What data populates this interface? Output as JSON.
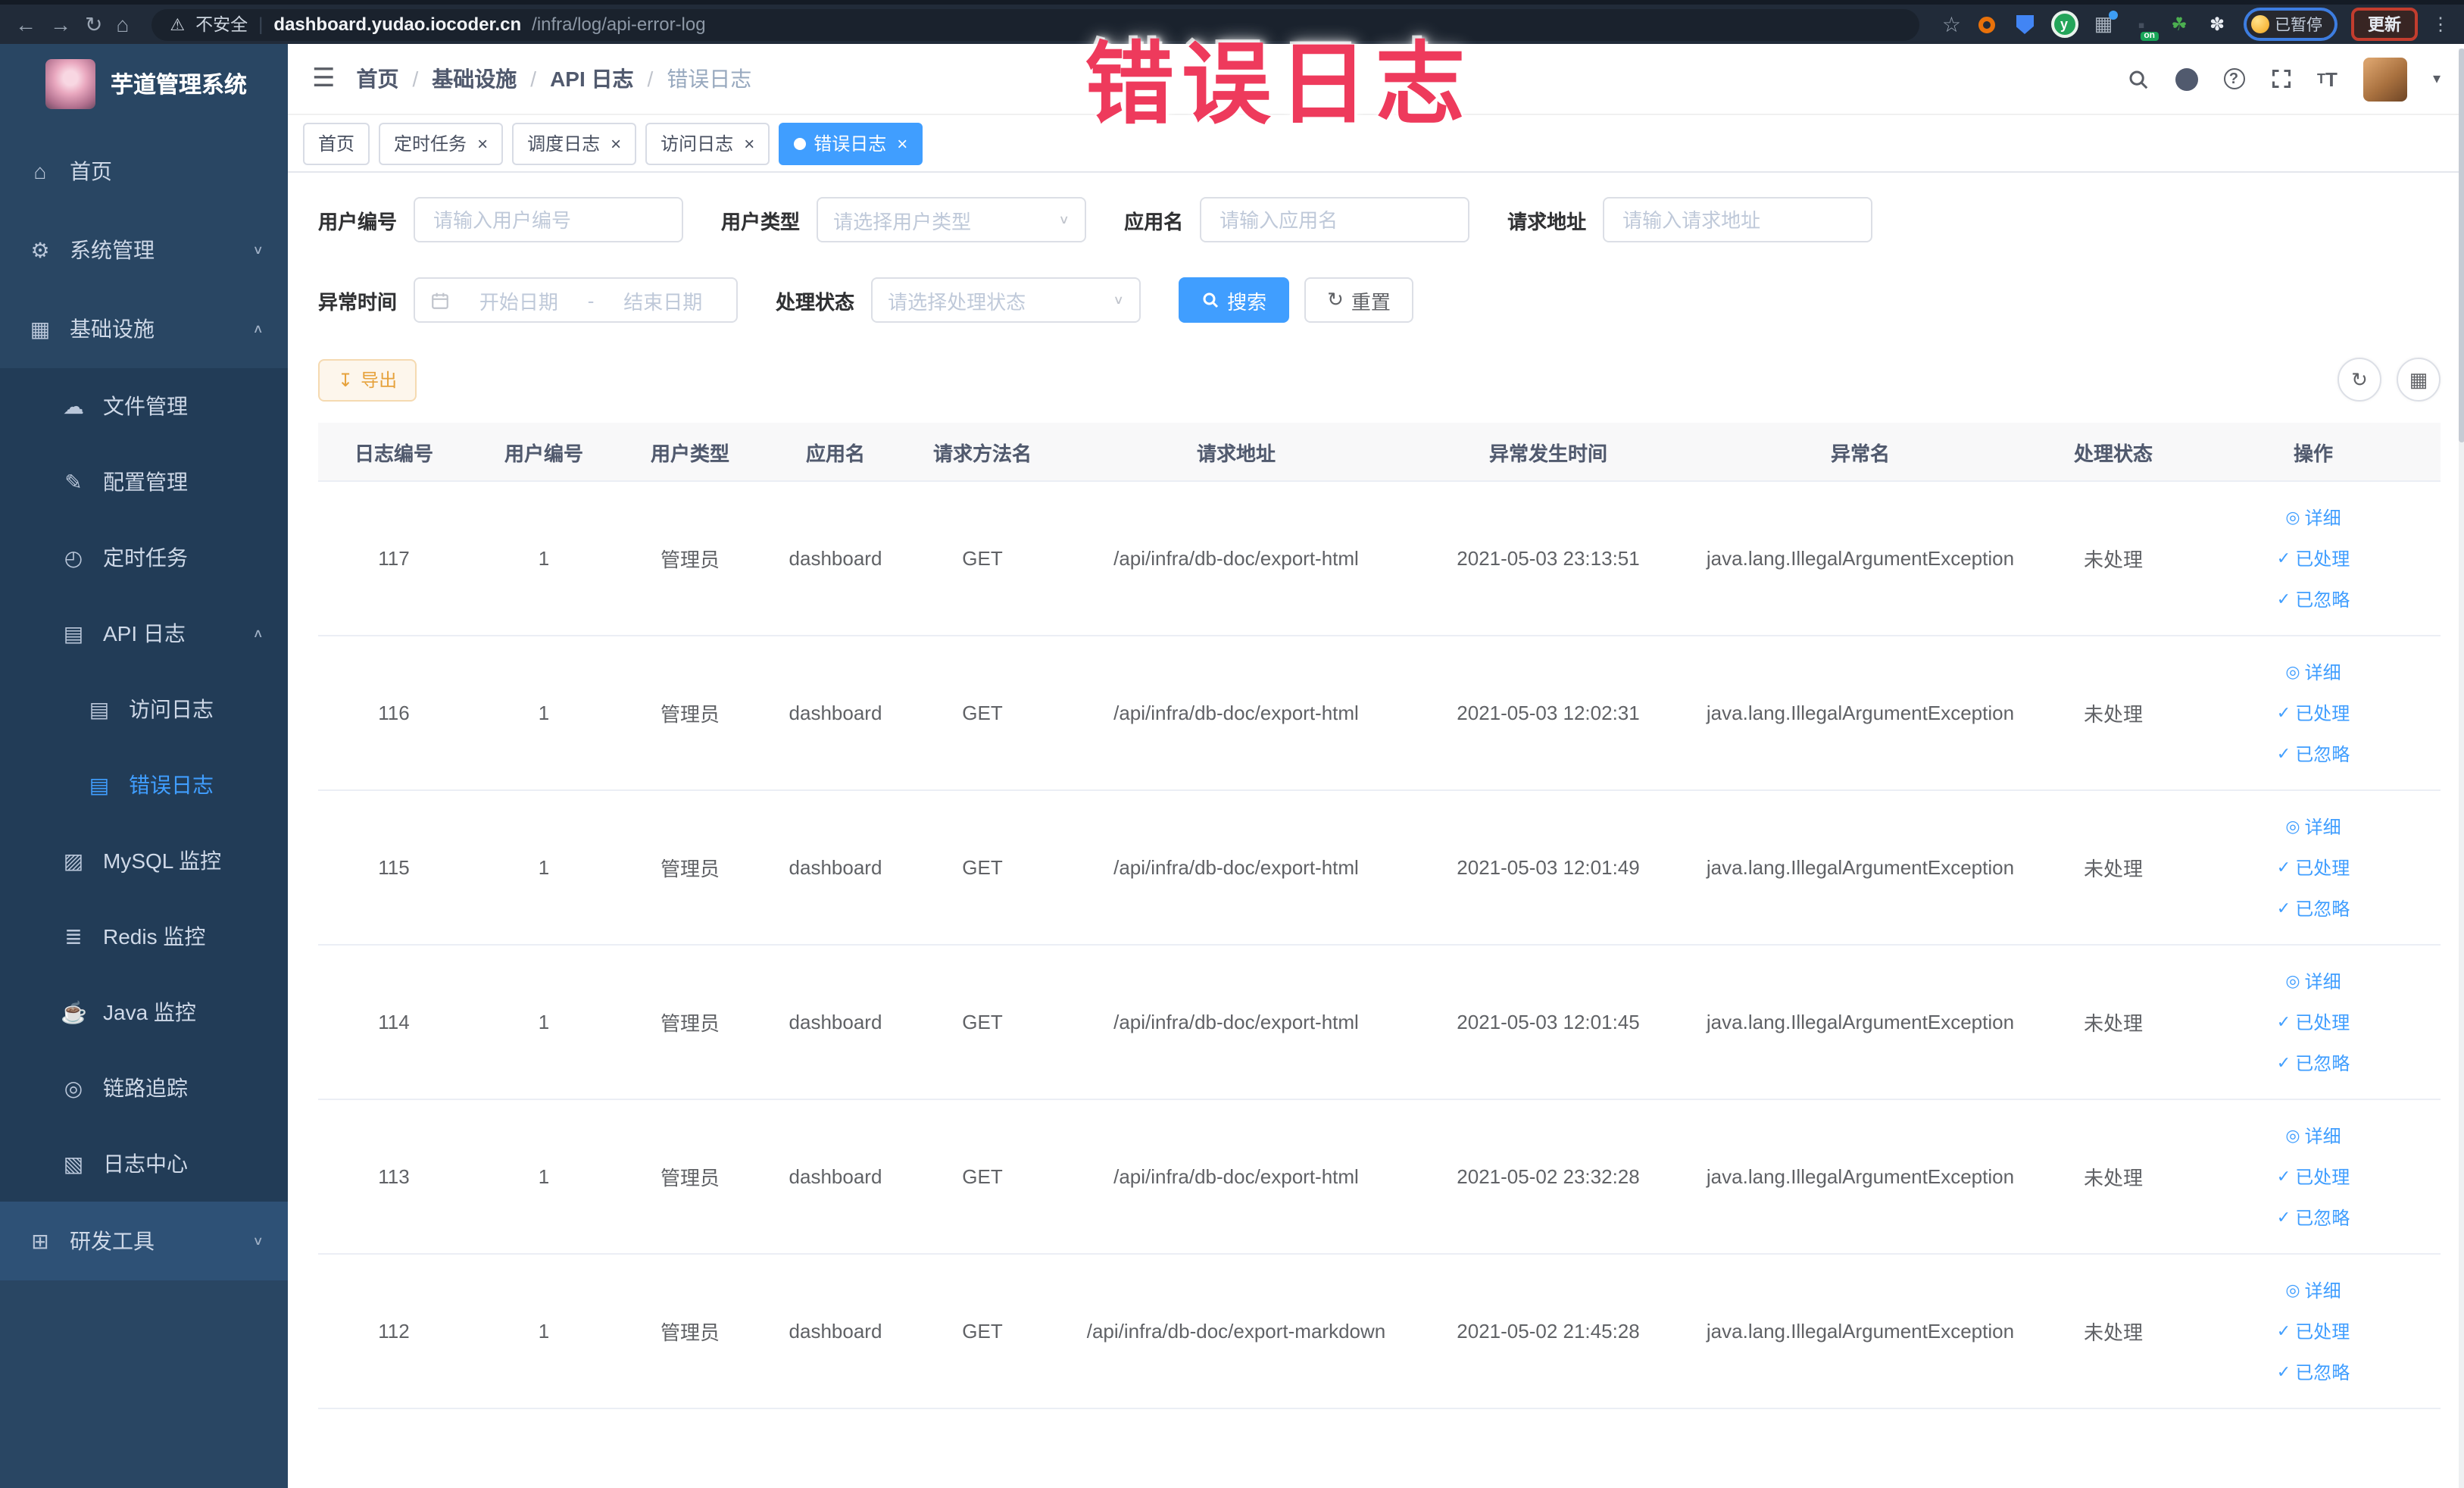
{
  "browser": {
    "security_warning": "不安全",
    "url_host": "dashboard.yudao.iocoder.cn",
    "url_path": "/infra/log/api-error-log",
    "extension_on_badge": "on",
    "extension_green_letter": "y",
    "paused_badge": "已暂停",
    "update_button": "更新"
  },
  "annotation": {
    "text": "错误日志",
    "color": "#ee3a5c"
  },
  "sidebar": {
    "title": "芋道管理系统",
    "items": [
      {
        "name": "home",
        "label": "首页",
        "icon": "home",
        "level": "top"
      },
      {
        "name": "system-management",
        "label": "系统管理",
        "icon": "gear",
        "level": "top",
        "chevron": "down"
      },
      {
        "name": "infrastructure",
        "label": "基础设施",
        "icon": "infra",
        "level": "top",
        "chevron": "up"
      },
      {
        "name": "file-management",
        "label": "文件管理",
        "icon": "cloud",
        "level": "sub"
      },
      {
        "name": "config-management",
        "label": "配置管理",
        "icon": "edit",
        "level": "sub"
      },
      {
        "name": "scheduled-tasks",
        "label": "定时任务",
        "icon": "timer",
        "level": "sub"
      },
      {
        "name": "api-log",
        "label": "API 日志",
        "icon": "doc",
        "level": "sub",
        "chevron": "up"
      },
      {
        "name": "access-log",
        "label": "访问日志",
        "icon": "doc",
        "level": "subsub"
      },
      {
        "name": "error-log",
        "label": "错误日志",
        "icon": "doc",
        "level": "subsub",
        "active": true
      },
      {
        "name": "mysql-monitor",
        "label": "MySQL 监控",
        "icon": "picture",
        "level": "sub"
      },
      {
        "name": "redis-monitor",
        "label": "Redis 监控",
        "icon": "coins",
        "level": "sub"
      },
      {
        "name": "java-monitor",
        "label": "Java 监控",
        "icon": "java",
        "level": "sub"
      },
      {
        "name": "trace",
        "label": "链路追踪",
        "icon": "eye",
        "level": "sub"
      },
      {
        "name": "log-center",
        "label": "日志中心",
        "icon": "doc2",
        "level": "sub"
      },
      {
        "name": "dev-tools",
        "label": "研发工具",
        "icon": "tools",
        "level": "tools",
        "chevron": "down"
      }
    ]
  },
  "breadcrumb": [
    "首页",
    "基础设施",
    "API 日志",
    "错误日志"
  ],
  "tabs": [
    {
      "label": "首页",
      "closable": false,
      "active": false
    },
    {
      "label": "定时任务",
      "closable": true,
      "active": false
    },
    {
      "label": "调度日志",
      "closable": true,
      "active": false
    },
    {
      "label": "访问日志",
      "closable": true,
      "active": false
    },
    {
      "label": "错误日志",
      "closable": true,
      "active": true
    }
  ],
  "filters": {
    "user_id": {
      "label": "用户编号",
      "placeholder": "请输入用户编号"
    },
    "user_type": {
      "label": "用户类型",
      "placeholder": "请选择用户类型"
    },
    "app_name": {
      "label": "应用名",
      "placeholder": "请输入应用名"
    },
    "request_url": {
      "label": "请求地址",
      "placeholder": "请输入请求地址"
    },
    "exception_time": {
      "label": "异常时间",
      "start_placeholder": "开始日期",
      "separator": "-",
      "end_placeholder": "结束日期"
    },
    "process_status": {
      "label": "处理状态",
      "placeholder": "请选择处理状态"
    },
    "search_button": "搜索",
    "reset_button": "重置"
  },
  "toolbar": {
    "export_button": "导出"
  },
  "table": {
    "columns": [
      "日志编号",
      "用户编号",
      "用户类型",
      "应用名",
      "请求方法名",
      "请求地址",
      "异常发生时间",
      "异常名",
      "处理状态",
      "操作"
    ],
    "rows": [
      {
        "cells": [
          "117",
          "1",
          "管理员",
          "dashboard",
          "GET",
          "/api/infra/db-doc/export-html",
          "2021-05-03 23:13:51",
          "java.lang.IllegalArgumentException",
          "未处理"
        ]
      },
      {
        "cells": [
          "116",
          "1",
          "管理员",
          "dashboard",
          "GET",
          "/api/infra/db-doc/export-html",
          "2021-05-03 12:02:31",
          "java.lang.IllegalArgumentException",
          "未处理"
        ]
      },
      {
        "cells": [
          "115",
          "1",
          "管理员",
          "dashboard",
          "GET",
          "/api/infra/db-doc/export-html",
          "2021-05-03 12:01:49",
          "java.lang.IllegalArgumentException",
          "未处理"
        ]
      },
      {
        "cells": [
          "114",
          "1",
          "管理员",
          "dashboard",
          "GET",
          "/api/infra/db-doc/export-html",
          "2021-05-03 12:01:45",
          "java.lang.IllegalArgumentException",
          "未处理"
        ]
      },
      {
        "cells": [
          "113",
          "1",
          "管理员",
          "dashboard",
          "GET",
          "/api/infra/db-doc/export-html",
          "2021-05-02 23:32:28",
          "java.lang.IllegalArgumentException",
          "未处理"
        ]
      },
      {
        "cells": [
          "112",
          "1",
          "管理员",
          "dashboard",
          "GET",
          "/api/infra/db-doc/export-markdown",
          "2021-05-02 21:45:28",
          "java.lang.IllegalArgumentException",
          "未处理"
        ]
      }
    ],
    "row_actions": [
      {
        "name": "detail",
        "icon": "eye",
        "label": "详细"
      },
      {
        "name": "processed",
        "icon": "check",
        "label": "已处理"
      },
      {
        "name": "ignored",
        "icon": "check",
        "label": "已忽略"
      }
    ]
  },
  "icons": {
    "back": "←",
    "forward": "→",
    "reload": "↻",
    "home_nav": "⌂",
    "warning": "⚠",
    "star": "☆",
    "grid_ext": "▦",
    "dark_ext": "▪",
    "plant": "☘",
    "puzzle": "✽",
    "menu_dots": "⋮",
    "hamburger": "☰",
    "caret": "▾",
    "home": "⌂",
    "gear": "⚙",
    "infra": "▦",
    "cloud": "☁",
    "edit": "✎",
    "timer": "◴",
    "doc": "▤",
    "doc2": "▧",
    "picture": "▨",
    "coins": "≣",
    "java": "☕",
    "eye": "◎",
    "tools": "⊞",
    "chevron_down": "∨",
    "chevron_up": "∧",
    "select_arrow": "∨",
    "close": "×",
    "refresh": "↻",
    "grid": "▦",
    "download": "↧",
    "check": "✓"
  },
  "colors": {
    "accent": "#409eff",
    "sidebar_bg": "#294663",
    "sidebar_submenu_bg": "#223c57",
    "sidebar_tools_bg": "#2e5176",
    "annotation_red": "#ee3a5c",
    "warning_btn_text": "#e6a23c",
    "table_header_bg": "#f8f8f9"
  }
}
